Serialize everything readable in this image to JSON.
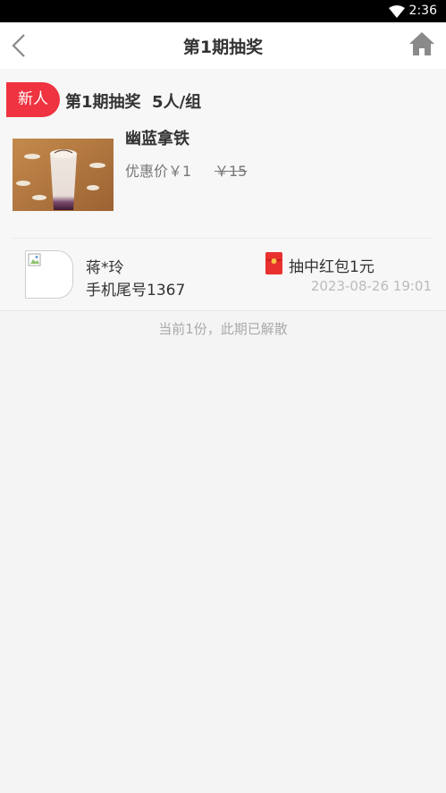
{
  "status_bar": {
    "time": "2:36",
    "wifi_icon": "wifi-icon"
  },
  "navbar": {
    "back_icon": "chevron-left-icon",
    "title": "第1期抽奖",
    "home_icon": "home-icon"
  },
  "group": {
    "badge": "新人",
    "title": "第1期抽奖  5人/组"
  },
  "product": {
    "image": "latte-photo",
    "name": "幽蓝拿铁",
    "price": "优惠价￥1",
    "original_price": "￥15"
  },
  "winner": {
    "avatar": "avatar-broken-image",
    "name": "蒋*玲",
    "phone": "手机尾号1367",
    "prize_icon": "red-packet-icon",
    "prize": "抽中红包1元",
    "time": "2023-08-26 19:01"
  },
  "footer": {
    "note": "当前1份，此期已解散"
  },
  "colors": {
    "accent": "#ef3340",
    "muted": "#aaaaaa"
  }
}
